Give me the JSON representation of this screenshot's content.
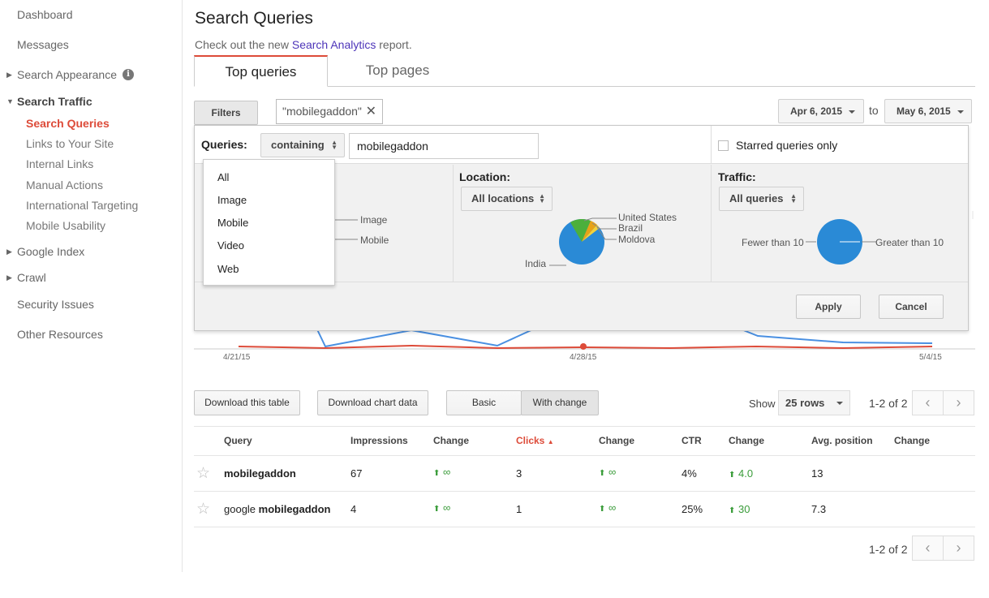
{
  "sidebar": {
    "top_items": [
      "Dashboard",
      "Messages"
    ],
    "search_appearance": "Search Appearance",
    "search_traffic": "Search Traffic",
    "search_traffic_items": [
      "Search Queries",
      "Links to Your Site",
      "Internal Links",
      "Manual Actions",
      "International Targeting",
      "Mobile Usability"
    ],
    "google_index": "Google Index",
    "crawl": "Crawl",
    "bottom_items": [
      "Security Issues",
      "Other Resources"
    ]
  },
  "header": {
    "title": "Search Queries",
    "subtitle_prefix": "Check out the new ",
    "subtitle_link": "Search Analytics",
    "subtitle_suffix": " report."
  },
  "tabs": [
    "Top queries",
    "Top pages"
  ],
  "toolbar": {
    "filters_label": "Filters",
    "filter_chip": "\"mobilegaddon\"",
    "date_from": "Apr 6, 2015",
    "to_label": "to",
    "date_to": "May 6, 2015"
  },
  "filter_panel": {
    "queries_label": "Queries:",
    "match_select": "containing",
    "query_value": "mobilegaddon",
    "starred_label": "Starred queries only",
    "location_title": "Location:",
    "location_select": "All locations",
    "traffic_title": "Traffic:",
    "traffic_select": "All queries",
    "search_pie_labels": [
      "Image",
      "Mobile"
    ],
    "location_pie_labels": [
      "United States",
      "Brazil",
      "Moldova",
      "India"
    ],
    "traffic_pie_labels": [
      "Fewer than 10",
      "Greater than 10"
    ],
    "apply_label": "Apply",
    "cancel_label": "Cancel",
    "dropdown_options": [
      "All",
      "Image",
      "Mobile",
      "Video",
      "Web"
    ]
  },
  "chart": {
    "x_ticks": [
      "4/21/15",
      "4/28/15",
      "5/4/15"
    ]
  },
  "table_controls": {
    "download_table": "Download this table",
    "download_chart": "Download chart data",
    "basic": "Basic",
    "with_change": "With change",
    "show_label": "Show",
    "rows_select": "25 rows",
    "pager": "1-2 of 2"
  },
  "table": {
    "headers": [
      "Query",
      "Impressions",
      "Change",
      "Clicks",
      "Change",
      "CTR",
      "Change",
      "Avg. position",
      "Change"
    ],
    "rows": [
      {
        "query_prefix": "",
        "query_bold": "mobilegaddon",
        "impressions": "67",
        "imp_change": "∞",
        "clicks": "3",
        "clicks_change": "∞",
        "ctr": "4%",
        "ctr_change": "4.0",
        "position": "13",
        "pos_change": ""
      },
      {
        "query_prefix": "google ",
        "query_bold": "mobilegaddon",
        "impressions": "4",
        "imp_change": "∞",
        "clicks": "1",
        "clicks_change": "∞",
        "ctr": "25%",
        "ctr_change": "30",
        "position": "7.3",
        "pos_change": ""
      }
    ]
  },
  "colors": {
    "accent_red": "#dd4b39",
    "link_purple": "#4d35b9",
    "change_green": "#3a9c3a",
    "pie_blue": "#2a8ad6",
    "pie_green": "#4caf3c",
    "pie_orange": "#e8a317",
    "pie_yellow": "#f3d23a"
  }
}
